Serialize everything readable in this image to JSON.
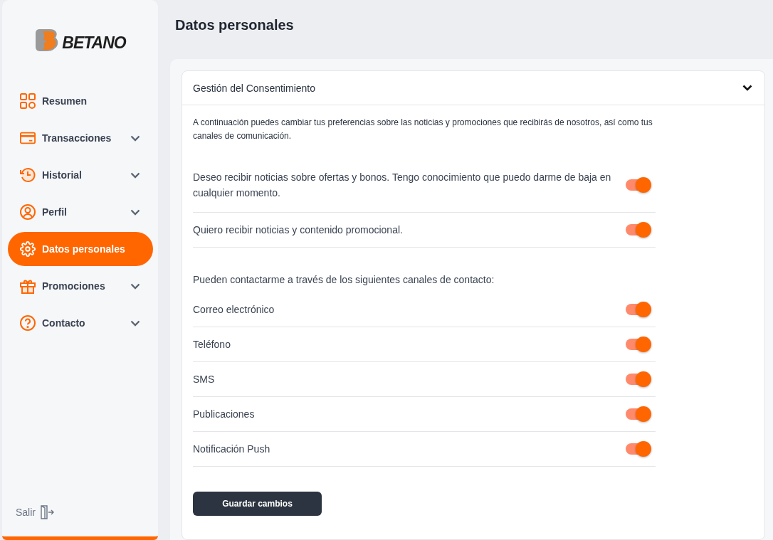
{
  "sidebar": {
    "logo": "BETANO",
    "items": [
      {
        "label": "Resumen",
        "kind": "grid",
        "expandable": false,
        "selected": false
      },
      {
        "label": "Transacciones",
        "kind": "card",
        "expandable": true,
        "selected": false
      },
      {
        "label": "Historial",
        "kind": "history",
        "expandable": true,
        "selected": false
      },
      {
        "label": "Perfil",
        "kind": "user",
        "expandable": true,
        "selected": false
      },
      {
        "label": "Datos personales",
        "kind": "gear",
        "expandable": false,
        "selected": true
      },
      {
        "label": "Promociones",
        "kind": "gift",
        "expandable": true,
        "selected": false
      },
      {
        "label": "Contacto",
        "kind": "question",
        "expandable": true,
        "selected": false
      }
    ],
    "logout": "Salir"
  },
  "page_title": "Datos personales",
  "section": {
    "title": "Gestión del Consentimiento",
    "expanded": true,
    "description": "A continuación puedes cambiar tus preferencias sobre las noticias y promociones que recibirás de nosotros, así como tus canales de comunicación.",
    "consents": [
      {
        "label": "Deseo recibir noticias sobre ofertas y bonos. Tengo conocimiento que puedo darme de baja en cualquier momento.",
        "on": true
      },
      {
        "label": "Quiero recibir noticias y contenido promocional.",
        "on": true
      }
    ],
    "channels_heading": "Pueden contactarme a través de los siguientes canales de contacto:",
    "channels": [
      {
        "label": "Correo electrónico",
        "on": true
      },
      {
        "label": "Teléfono",
        "on": true
      },
      {
        "label": "SMS",
        "on": true
      },
      {
        "label": "Publicaciones",
        "on": true
      },
      {
        "label": "Notificación Push",
        "on": true
      }
    ],
    "save_button": "Guardar cambios"
  }
}
